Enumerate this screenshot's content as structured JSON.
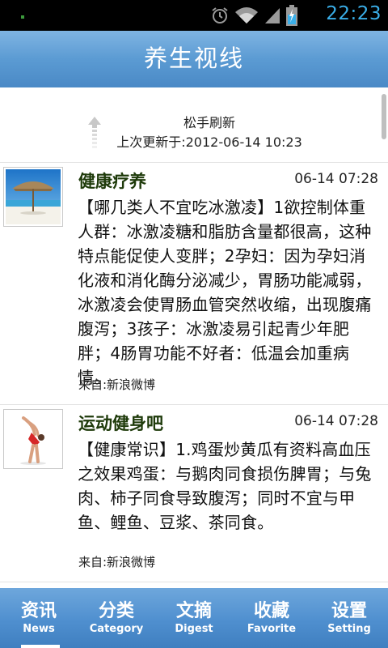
{
  "status_bar": {
    "time": "22:23",
    "icons": [
      "alarm-icon",
      "wifi-icon",
      "signal-icon",
      "battery-charging-icon"
    ]
  },
  "app": {
    "title": "养生视线"
  },
  "refresh": {
    "label": "松手刷新",
    "last_updated": "上次更新于:2012-06-14 10:23"
  },
  "feed": [
    {
      "source": "健康疗养",
      "time": "06-14 07:28",
      "body": "【哪几类人不宜吃冰激凌】1欲控制体重人群：冰激凌糖和脂肪含量都很高，这种特点能促使人变胖；2孕妇：因为孕妇消化液和消化酶分泌减少，胃肠功能减弱，冰激凌会使胃肠血管突然收缩，出现腹痛腹泻；3孩子：冰激凌易引起青少年肥胖；4肠胃功能不好者：低温会加重病情。",
      "from": "来自:新浪微博",
      "thumbnail": "beach-umbrella-image"
    },
    {
      "source": "运动健身吧",
      "time": "06-14 07:28",
      "body": "【健康常识】1.鸡蛋炒黄瓜有资料高血压之效果鸡蛋：与鹅肉同食损伤脾胃；与兔肉、柿子同食导致腹泻；同时不宜与甲鱼、鲤鱼、豆浆、茶同食。",
      "from": "来自:新浪微博",
      "thumbnail": "gymnast-image"
    }
  ],
  "tabs": [
    {
      "zh": "资讯",
      "en": "News",
      "active": true
    },
    {
      "zh": "分类",
      "en": "Category",
      "active": false
    },
    {
      "zh": "文摘",
      "en": "Digest",
      "active": false
    },
    {
      "zh": "收藏",
      "en": "Favorite",
      "active": false
    },
    {
      "zh": "设置",
      "en": "Setting",
      "active": false
    }
  ],
  "colors": {
    "title_bar": "#5b9bd3",
    "tab_bar": "#4f8fcf",
    "status_time": "#3aaee8",
    "source_text": "#1e3a0a"
  }
}
